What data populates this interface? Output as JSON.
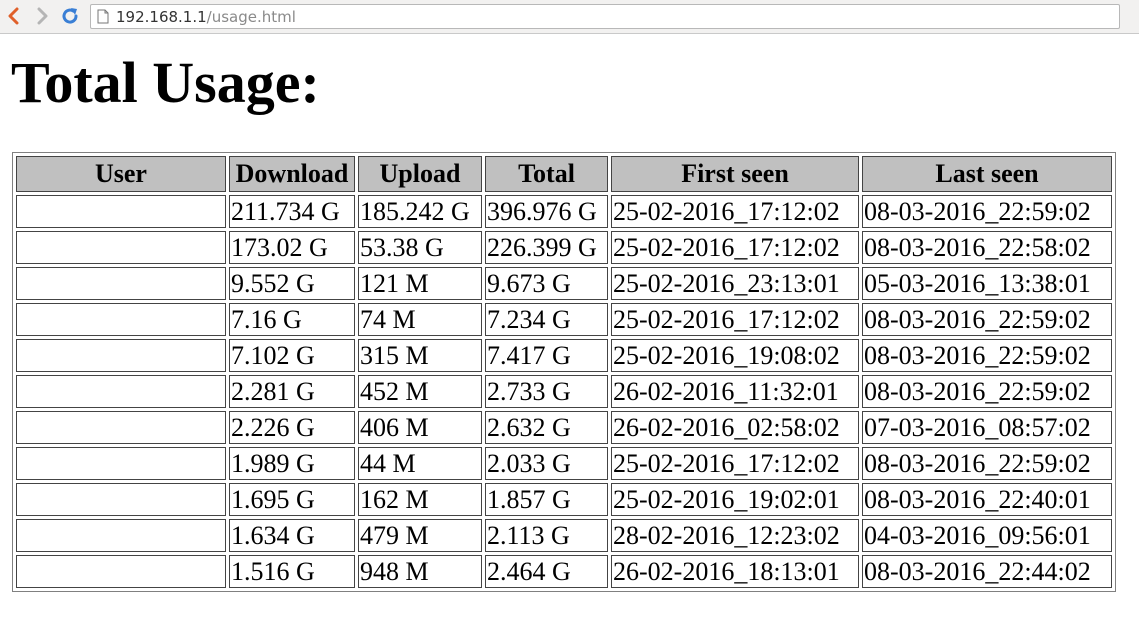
{
  "browser": {
    "url_host": "192.168.1.1",
    "url_path": "/usage.html"
  },
  "page": {
    "title": "Total Usage:"
  },
  "table": {
    "headers": [
      "User",
      "Download",
      "Upload",
      "Total",
      "First seen",
      "Last seen"
    ],
    "rows": [
      [
        "",
        "211.734 G",
        "185.242 G",
        "396.976 G",
        "25-02-2016_17:12:02",
        "08-03-2016_22:59:02"
      ],
      [
        "",
        "173.02 G",
        "53.38 G",
        "226.399 G",
        "25-02-2016_17:12:02",
        "08-03-2016_22:58:02"
      ],
      [
        "",
        "9.552 G",
        "121 M",
        "9.673 G",
        "25-02-2016_23:13:01",
        "05-03-2016_13:38:01"
      ],
      [
        "",
        "7.16 G",
        "74 M",
        "7.234 G",
        "25-02-2016_17:12:02",
        "08-03-2016_22:59:02"
      ],
      [
        "",
        "7.102 G",
        "315 M",
        "7.417 G",
        "25-02-2016_19:08:02",
        "08-03-2016_22:59:02"
      ],
      [
        "",
        "2.281 G",
        "452 M",
        "2.733 G",
        "26-02-2016_11:32:01",
        "08-03-2016_22:59:02"
      ],
      [
        "",
        "2.226 G",
        "406 M",
        "2.632 G",
        "26-02-2016_02:58:02",
        "07-03-2016_08:57:02"
      ],
      [
        "",
        "1.989 G",
        "44 M",
        "2.033 G",
        "25-02-2016_17:12:02",
        "08-03-2016_22:59:02"
      ],
      [
        "",
        "1.695 G",
        "162 M",
        "1.857 G",
        "25-02-2016_19:02:01",
        "08-03-2016_22:40:01"
      ],
      [
        "",
        "1.634 G",
        "479 M",
        "2.113 G",
        "28-02-2016_12:23:02",
        "04-03-2016_09:56:01"
      ],
      [
        "",
        "1.516 G",
        "948 M",
        "2.464 G",
        "26-02-2016_18:13:01",
        "08-03-2016_22:44:02"
      ]
    ]
  },
  "colors": {
    "header_bg": "#c0c0c0",
    "back_arrow": "#e0602a",
    "reload": "#3a7fd5"
  }
}
